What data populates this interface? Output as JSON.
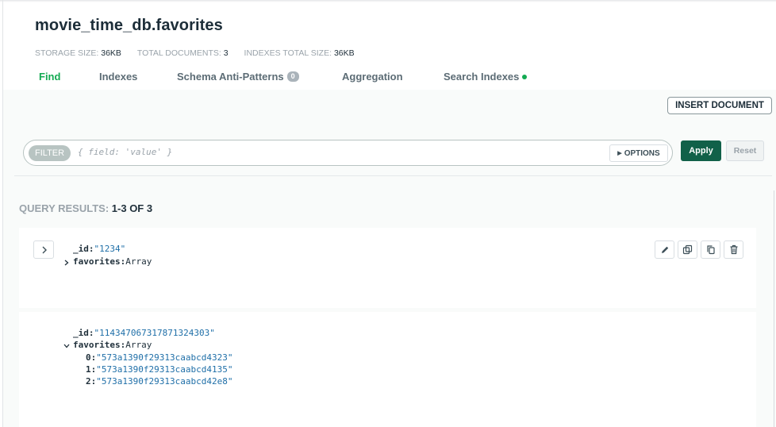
{
  "collection": {
    "title": "movie_time_db.favorites",
    "stats": [
      {
        "label": "STORAGE SIZE:",
        "value": "36KB"
      },
      {
        "label": "TOTAL DOCUMENTS:",
        "value": "3"
      },
      {
        "label": "INDEXES TOTAL SIZE:",
        "value": "36KB"
      }
    ]
  },
  "tabs": [
    {
      "label": "Find",
      "active": true
    },
    {
      "label": "Indexes"
    },
    {
      "label": "Schema Anti-Patterns",
      "badge": "0"
    },
    {
      "label": "Aggregation"
    },
    {
      "label": "Search Indexes",
      "dot": true
    }
  ],
  "toolbar": {
    "insert_label": "INSERT DOCUMENT",
    "filter_label": "FILTER",
    "filter_placeholder": "{ field: 'value' }",
    "options_label": "OPTIONS",
    "apply_label": "Apply",
    "reset_label": "Reset"
  },
  "results": {
    "label": "QUERY RESULTS:",
    "count": "1-3 OF 3"
  },
  "documents": [
    {
      "id_key": "_id:",
      "id_value": "\"1234\"",
      "fav_key": "favorites:",
      "fav_type": "Array",
      "expanded": false
    },
    {
      "id_key": "_id:",
      "id_value": "\"114347067317871324303\"",
      "fav_key": "favorites:",
      "fav_type": "Array",
      "expanded": true,
      "items": [
        {
          "index": "0:",
          "value": "\"573a1390f29313caabcd4323\""
        },
        {
          "index": "1:",
          "value": "\"573a1390f29313caabcd4135\""
        },
        {
          "index": "2:",
          "value": "\"573a1390f29313caabcd42e8\""
        }
      ]
    }
  ],
  "icons": {
    "expand": "chevron-right-icon",
    "edit": "pencil-icon",
    "copy": "copy-icon",
    "clone": "clone-icon",
    "delete": "trash-icon"
  },
  "colors": {
    "accent_green": "#13aa52",
    "apply_bg": "#116149",
    "string_value": "#1f6fa8"
  }
}
